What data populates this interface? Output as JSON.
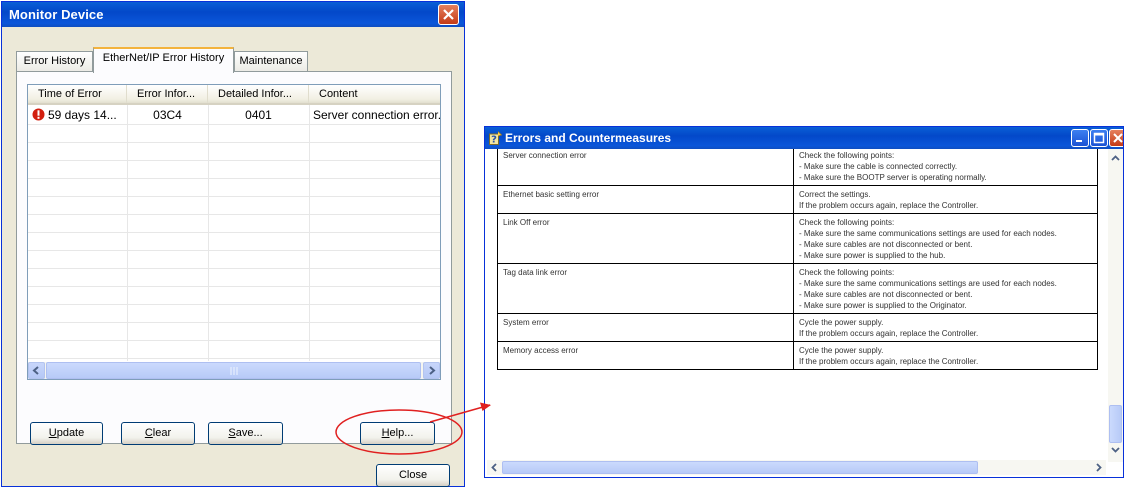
{
  "monitor": {
    "title": "Monitor Device",
    "tabs": [
      "Error History",
      "EtherNet/IP Error History",
      "Maintenance"
    ],
    "active_tab": "EtherNet/IP Error History",
    "columns": [
      "Time of Error",
      "Error Infor...",
      "Detailed Infor...",
      "Content"
    ],
    "rows": [
      {
        "time": "59 days 14...",
        "error_info": "03C4",
        "detailed_info": "0401",
        "content": "Server connection error."
      }
    ],
    "buttons": {
      "update": "Update",
      "clear": "Clear",
      "save": "Save...",
      "help": "Help...",
      "close": "Close"
    }
  },
  "errors_window": {
    "title": "Errors and Countermeasures",
    "rows": [
      {
        "error": "Server connection error",
        "countermeasure": [
          "Check the following points:",
          "- Make sure the cable is connected correctly.",
          "- Make sure the BOOTP server is operating normally."
        ]
      },
      {
        "error": "Ethernet basic setting error",
        "countermeasure": [
          "Correct the settings.",
          "If the problem occurs again, replace the Controller."
        ]
      },
      {
        "error": "Link Off error",
        "countermeasure": [
          "Check the following points:",
          "- Make sure the same communications settings are used for each nodes.",
          "- Make sure cables are not disconnected or bent.",
          "- Make sure power is supplied to the hub."
        ]
      },
      {
        "error": "Tag data link error",
        "countermeasure": [
          "Check the following points:",
          "- Make sure the same communications settings are used for each nodes.",
          "- Make sure cables are not disconnected or bent.",
          "- Make sure power is supplied to the Originator."
        ]
      },
      {
        "error": "System error",
        "countermeasure": [
          "Cycle the power supply.",
          "If the problem occurs again, replace the Controller."
        ]
      },
      {
        "error": "Memory access error",
        "countermeasure": [
          "Cycle the power supply.",
          "If the problem occurs again, replace the Controller."
        ]
      }
    ]
  },
  "colors": {
    "annotation": "#e02020",
    "titlebar": "#0348c9",
    "error_icon": "#d21f0f"
  },
  "icons": [
    "close-icon",
    "error-icon",
    "help-icon",
    "minimize-icon",
    "maximize-icon",
    "scroll-left-icon",
    "scroll-right-icon",
    "scroll-up-icon",
    "scroll-down-icon"
  ]
}
